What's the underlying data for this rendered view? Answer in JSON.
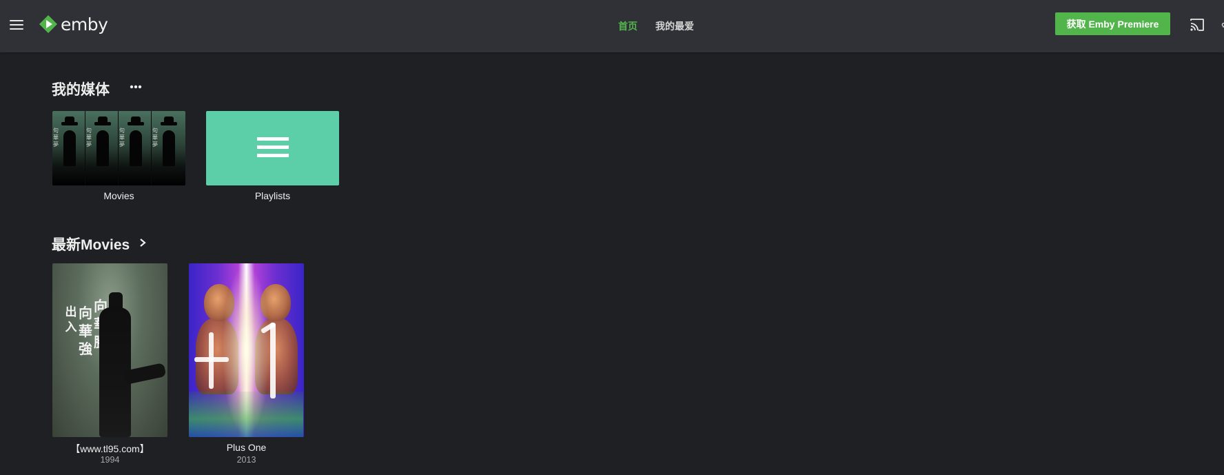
{
  "header": {
    "brand": "emby",
    "nav_tabs": [
      {
        "label": "首页",
        "active": true
      },
      {
        "label": "我的最爱",
        "active": false
      }
    ],
    "premiere_button": "获取 Emby Premiere",
    "icons": {
      "menu": "hamburger-menu-icon",
      "logo": "emby-logo-icon",
      "cast": "cast-icon"
    }
  },
  "my_media": {
    "title": "我的媒体",
    "more_icon": "more-horizontal-icon",
    "libraries": [
      {
        "label": "Movies"
      },
      {
        "label": "Playlists"
      }
    ]
  },
  "latest_movies": {
    "title": "最新Movies",
    "chevron_icon": "chevron-right-icon",
    "items": [
      {
        "title": "【www.tl95.com】",
        "year": "1994",
        "poster_text": [
          "出",
          "入",
          "向",
          "華",
          "強",
          "向",
          "華",
          "勝"
        ]
      },
      {
        "title": "Plus One",
        "year": "2013"
      }
    ]
  },
  "colors": {
    "accent": "#52b54b",
    "header_bg": "#303136",
    "page_bg": "#1f2024",
    "playlist_tile": "#5ccfa8"
  }
}
